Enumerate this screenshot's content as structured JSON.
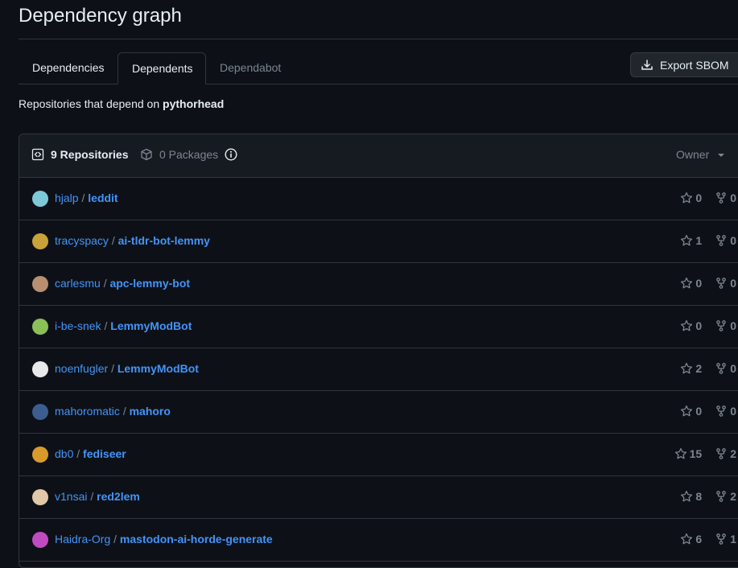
{
  "page": {
    "title": "Dependency graph"
  },
  "tabs": [
    {
      "label": "Dependencies"
    },
    {
      "label": "Dependents"
    },
    {
      "label": "Dependabot"
    }
  ],
  "export_button": {
    "label": "Export SBOM"
  },
  "subtitle": {
    "prefix": "Repositories that depend on ",
    "package": "pythorhead"
  },
  "list_header": {
    "repositories_label": "9 Repositories",
    "packages_label": "0 Packages",
    "owner_filter": "Owner"
  },
  "dependents": [
    {
      "owner": "hjalp",
      "repo": "leddit",
      "stars": "0",
      "forks": "0",
      "avatar_color": "#7ec8d8"
    },
    {
      "owner": "tracyspacy",
      "repo": "ai-tldr-bot-lemmy",
      "stars": "1",
      "forks": "0",
      "avatar_color": "#c9a23a"
    },
    {
      "owner": "carlesmu",
      "repo": "apc-lemmy-bot",
      "stars": "0",
      "forks": "0",
      "avatar_color": "#b89070"
    },
    {
      "owner": "i-be-snek",
      "repo": "LemmyModBot",
      "stars": "0",
      "forks": "0",
      "avatar_color": "#8bbf5a"
    },
    {
      "owner": "noenfugler",
      "repo": "LemmyModBot",
      "stars": "2",
      "forks": "0",
      "avatar_color": "#e8e8e8"
    },
    {
      "owner": "mahoromatic",
      "repo": "mahoro",
      "stars": "0",
      "forks": "0",
      "avatar_color": "#3b5d8f"
    },
    {
      "owner": "db0",
      "repo": "fediseer",
      "stars": "15",
      "forks": "2",
      "avatar_color": "#d89a2b"
    },
    {
      "owner": "v1nsai",
      "repo": "red2lem",
      "stars": "8",
      "forks": "2",
      "avatar_color": "#e0c8a8"
    },
    {
      "owner": "Haidra-Org",
      "repo": "mastodon-ai-horde-generate",
      "stars": "6",
      "forks": "1",
      "avatar_color": "#c04ac0"
    }
  ],
  "colors": {
    "background": "#0d1117",
    "link": "#4493f8",
    "muted": "#7d8590",
    "border": "#30363d"
  }
}
